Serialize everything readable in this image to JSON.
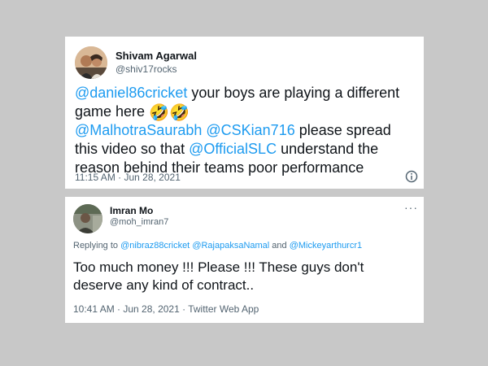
{
  "tweet1": {
    "display_name": "Shivam Agarwal",
    "handle": "@shiv17rocks",
    "mention1": "@daniel86cricket",
    "text1": " your boys are playing a different game here ",
    "emoji": "🤣🤣",
    "mention2": "@MalhotraSaurabh",
    "mention3": "@CSKian716",
    "text2": " please spread this video so that ",
    "mention4": "@OfficialSLC",
    "text3": " understand the reason behind their teams poor performance",
    "timestamp": "11:15 AM · Jun 28, 2021",
    "info_icon": "info-circle-icon"
  },
  "tweet2": {
    "display_name": "Imran Mo",
    "handle": "@moh_imran7",
    "more_icon": "···",
    "replying_prefix": "Replying to ",
    "reply_user1": "@nibraz88cricket",
    "reply_user2": "@RajapaksaNamal",
    "reply_and": " and ",
    "reply_user3": "@Mickeyarthurcr1",
    "text": "Too much money !!! Please !!! These guys don't deserve any kind of contract..",
    "timestamp": "10:41 AM · Jun 28, 2021 · Twitter Web App"
  },
  "colors": {
    "background": "#c8c8c8",
    "card": "#ffffff",
    "mention": "#1d9bf0",
    "muted": "#536471",
    "text": "#0f1419"
  }
}
